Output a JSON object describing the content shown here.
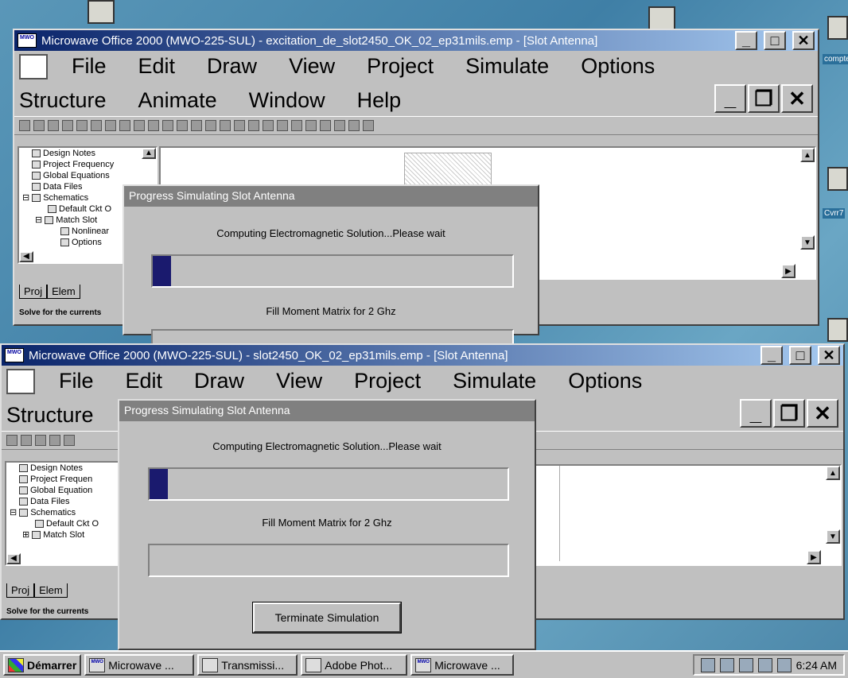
{
  "window_top": {
    "title": "Microwave Office 2000 (MWO-225-SUL) - excitation_de_slot2450_OK_02_ep31mils.emp - [Slot Antenna]",
    "menu_row1": [
      "File",
      "Edit",
      "Draw",
      "View",
      "Project",
      "Simulate",
      "Options"
    ],
    "menu_row2": [
      "Structure",
      "Animate",
      "Window",
      "Help"
    ],
    "tree_items": [
      "Design Notes",
      "Project Frequency",
      "Global Equations",
      "Data Files",
      "Schematics",
      "Default Ckt O",
      "Match Slot",
      "Nonlinear",
      "Options"
    ],
    "tabs": [
      "Proj",
      "Elem"
    ],
    "status": "Solve for the currents"
  },
  "window_bottom": {
    "title": "Microwave Office 2000 (MWO-225-SUL) - slot2450_OK_02_ep31mils.emp - [Slot Antenna]",
    "menu_row1": [
      "File",
      "Edit",
      "Draw",
      "View",
      "Project",
      "Simulate",
      "Options"
    ],
    "menu_row2": [
      "Structure"
    ],
    "tree_items": [
      "Design Notes",
      "Project Frequen",
      "Global Equation",
      "Data Files",
      "Schematics",
      "Default Ckt O",
      "Match Slot"
    ],
    "tabs": [
      "Proj",
      "Elem"
    ],
    "status": "Solve for the currents"
  },
  "dialog_top": {
    "title": "Progress Simulating Slot Antenna",
    "message": "Computing Electromagnetic Solution...Please wait",
    "progress1": 0.05,
    "message2": "Fill Moment Matrix for 2 Ghz"
  },
  "dialog_bottom": {
    "title": "Progress Simulating Slot Antenna",
    "message": "Computing Electromagnetic Solution...Please wait",
    "progress1": 0.05,
    "message2": "Fill Moment Matrix for 2 Ghz",
    "progress2": 0.0,
    "button": "Terminate Simulation"
  },
  "desktop_labels": [
    "compte",
    "Cvrr7"
  ],
  "taskbar": {
    "start": "Démarrer",
    "items": [
      "Microwave ...",
      "Transmissi...",
      "Adobe Phot...",
      "Microwave ..."
    ],
    "clock": "6:24 AM"
  },
  "icons": {
    "mwo_badge": "MWO"
  },
  "colors": {
    "title_active": "#0a246a",
    "progress": "#1a1a6e",
    "desktop": "#4b86a8"
  }
}
